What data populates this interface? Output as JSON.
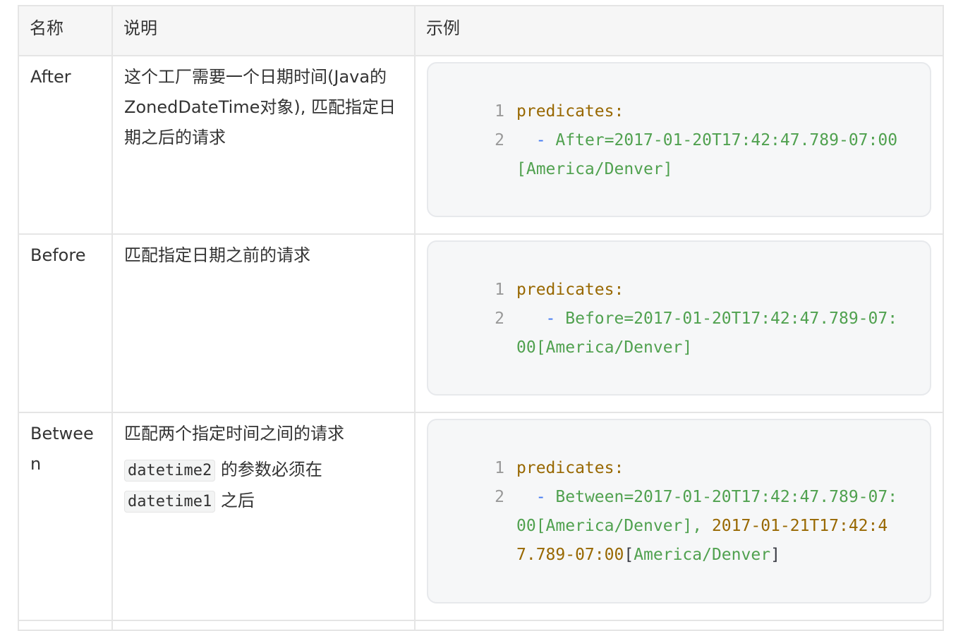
{
  "table": {
    "headers": [
      "名称",
      "说明",
      "示例"
    ],
    "rows": [
      {
        "name": "After",
        "desc": "这个工厂需要一个日期时间(Java的 ZonedDateTime对象), 匹配指定日期之后的请求",
        "lines": [
          {
            "no": "1",
            "key": "predicates:"
          },
          {
            "no": "2",
            "pad": "  ",
            "dash": "-",
            "val": " After=2017-01-20T17:42:47.789-07:00[America/Denver]"
          }
        ]
      },
      {
        "name": "Before",
        "desc": "匹配指定日期之前的请求",
        "lines": [
          {
            "no": "1",
            "key": "predicates:"
          },
          {
            "no": "2",
            "pad": "   ",
            "dash": "-",
            "val": " Before=2017-01-20T17:42:47.789-07:00[America/Denver]"
          }
        ]
      },
      {
        "name": "Between",
        "desc": "匹配两个指定时间之间的请求",
        "param1": "datetime2",
        "note1": " 的参数必须在",
        "param2": "datetime1",
        "note2": " 之后",
        "lines": [
          {
            "no": "1",
            "key": "predicates:"
          },
          {
            "no": "2",
            "pad": "  ",
            "dash": "-",
            "val": " Between=2017-01-20T17:42:47.789-07:00[America/Denver], ",
            "val2": "2017-01-21T17:42:47.789-07:00",
            "val3": "[",
            "val4": "America/Denver",
            "val5": "]"
          }
        ]
      }
    ]
  },
  "colors": {
    "key": "#986801",
    "string": "#50a14f",
    "dash": "#4078f2",
    "line_number": "#999999",
    "header_bg": "#f6f6f6",
    "code_bg": "#f6f7f8"
  }
}
